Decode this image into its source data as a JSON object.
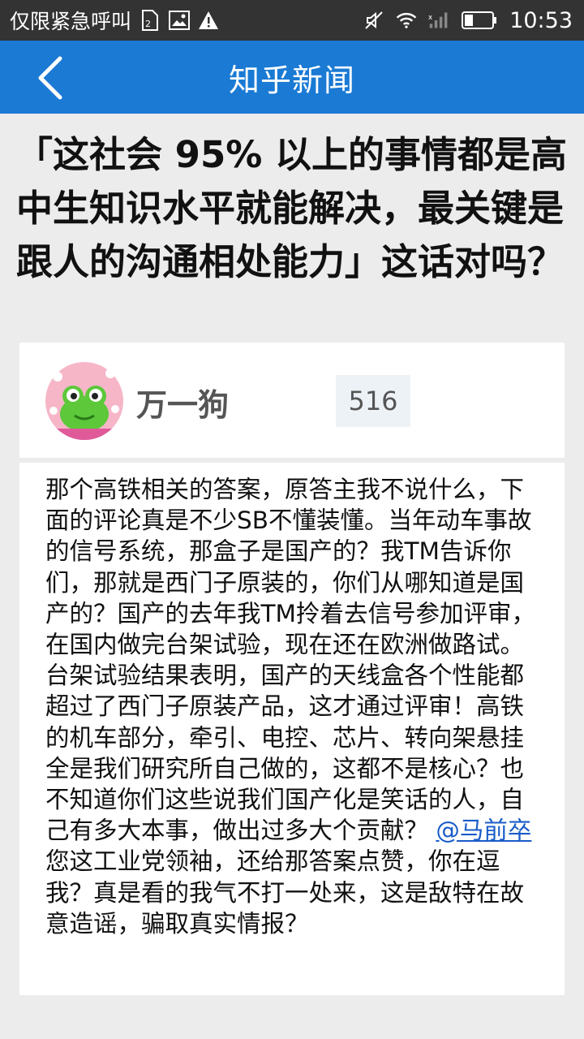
{
  "status_bar": {
    "carrier": "仅限紧急呼叫",
    "time": "10:53",
    "icons": [
      "sim-card-icon",
      "image-icon",
      "warning-icon",
      "mute-icon",
      "wifi-icon",
      "signal-icon",
      "battery-icon"
    ]
  },
  "app_bar": {
    "title": "知乎新闻",
    "back_icon": "chevron-left-icon",
    "color": "#1a7ad4"
  },
  "question": {
    "title": "「这社会 95% 以上的事情都是高中生知识水平就能解决，最关键是跟人的沟通相处能力」这话对吗？"
  },
  "author": {
    "name": "万一狗",
    "votes": "516"
  },
  "answer": {
    "text_before": "那个高铁相关的答案，原答主我不说什么，下面的评论真是不少SB不懂装懂。当年动车事故的信号系统，那盒子是国产的？我TM告诉你们，那就是西门子原装的，你们从哪知道是国产的？国产的去年我TM拎着去信号参加评审，在国内做完台架试验，现在还在欧洲做路试。台架试验结果表明，国产的天线盒各个性能都超过了西门子原装产品，这才通过评审！高铁的机车部分，牵引、电控、芯片、转向架悬挂全是我们研究所自己做的，这都不是核心？也不知道你们这些说我们国产化是笑话的人，自己有多大本事，做出过多大个贡献？ ",
    "mention": "@马前卒",
    "text_after": "您这工业党领袖，还给那答案点赞，你在逗我？真是看的我气不打一处来，这是敌特在故意造谣，骗取真实情报？"
  }
}
